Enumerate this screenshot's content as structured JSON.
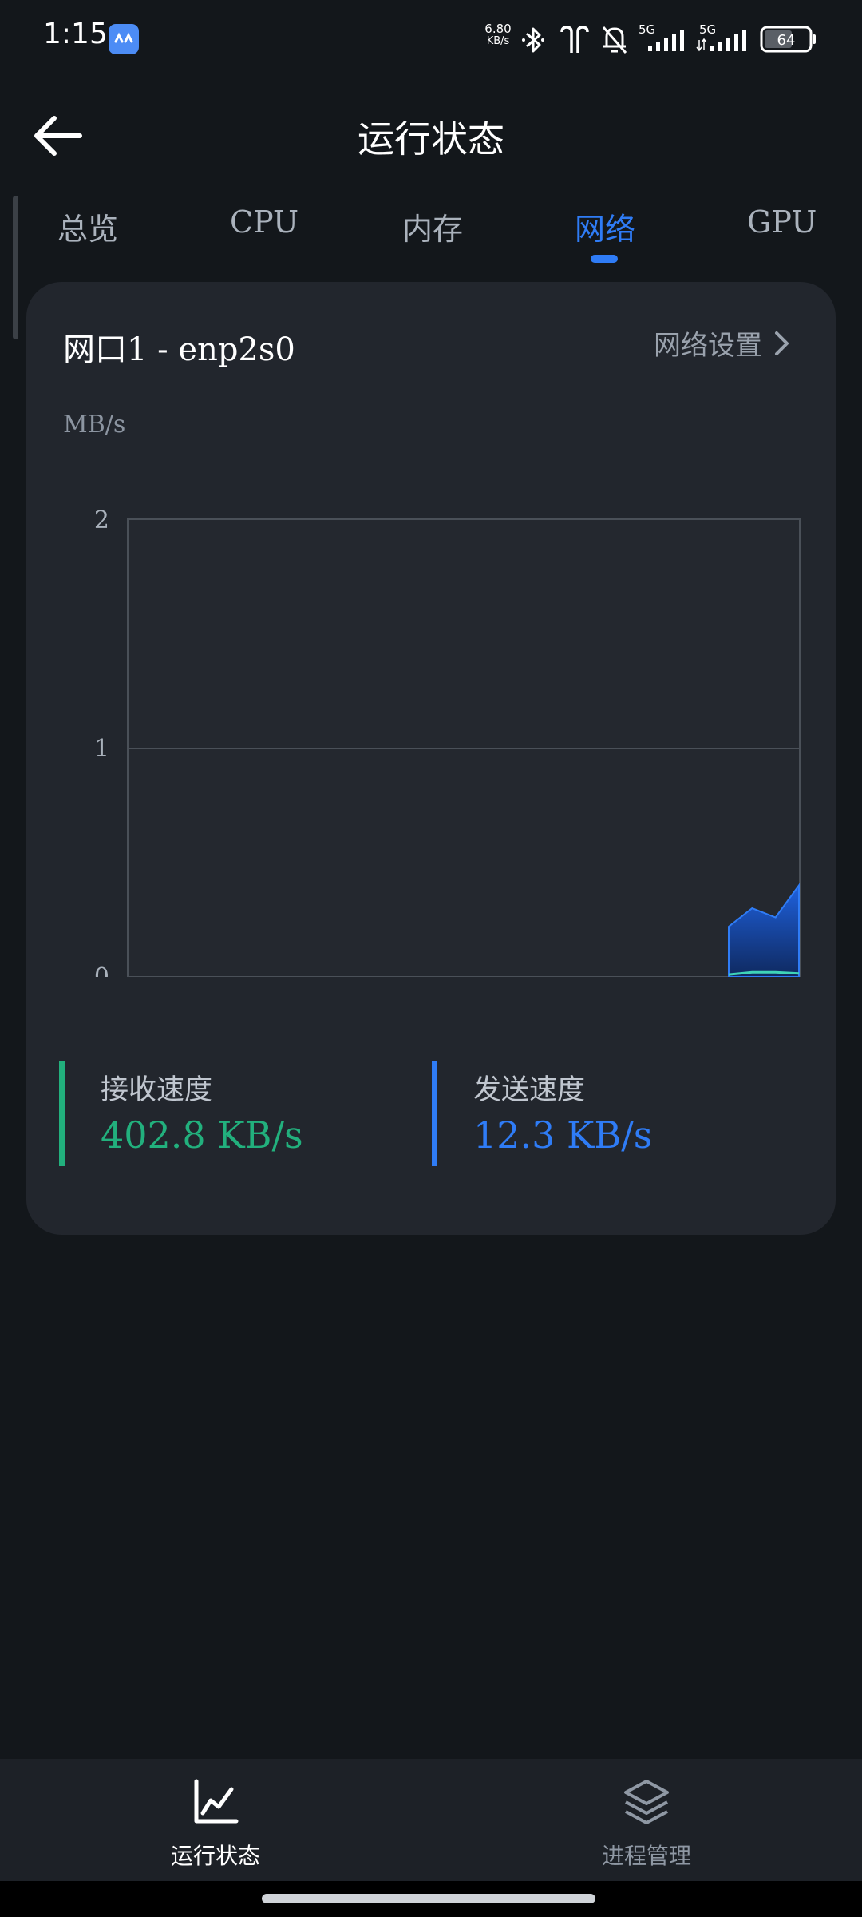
{
  "status_bar": {
    "time": "1:15",
    "net_speed_value": "6.80",
    "net_speed_unit": "KB/s",
    "signal1_label": "5G",
    "signal2_label": "5G",
    "battery": "64",
    "icons": [
      "app-icon",
      "bluetooth-icon",
      "earbuds-icon",
      "mute-bell-icon",
      "signal-icon",
      "battery-icon"
    ]
  },
  "header": {
    "title": "运行状态",
    "back_icon": "arrow-left-icon"
  },
  "tabs": [
    {
      "label": "总览",
      "active": false
    },
    {
      "label": "CPU",
      "active": false
    },
    {
      "label": "内存",
      "active": false
    },
    {
      "label": "网络",
      "active": true
    },
    {
      "label": "GPU",
      "active": false
    }
  ],
  "card": {
    "title": "网口1 - enp2s0",
    "settings_label": "网络设置",
    "settings_icon": "chevron-right-icon"
  },
  "chart_data": {
    "type": "area",
    "ylabel": "MB/s",
    "ylim": [
      0,
      2
    ],
    "yticks": [
      "0",
      "1",
      "2"
    ],
    "grid": true,
    "series": [
      {
        "color": "#2f7cf6",
        "values": [
          0.22,
          0.3,
          0.26,
          0.4
        ]
      },
      {
        "color": "#3fd3b8",
        "values": [
          0.01,
          0.02,
          0.02,
          0.015
        ]
      }
    ]
  },
  "stats": {
    "receive": {
      "label": "接收速度",
      "value": "402.8 KB/s",
      "color": "#22b07d"
    },
    "send": {
      "label": "发送速度",
      "value": "12.3 KB/s",
      "color": "#2f7cf6"
    }
  },
  "bottom_nav": [
    {
      "label": "运行状态",
      "icon": "line-chart-icon",
      "active": true
    },
    {
      "label": "进程管理",
      "icon": "layers-icon",
      "active": false
    }
  ],
  "colors": {
    "accent": "#2f7cf6",
    "background": "#13171b",
    "card": "#22262d"
  }
}
